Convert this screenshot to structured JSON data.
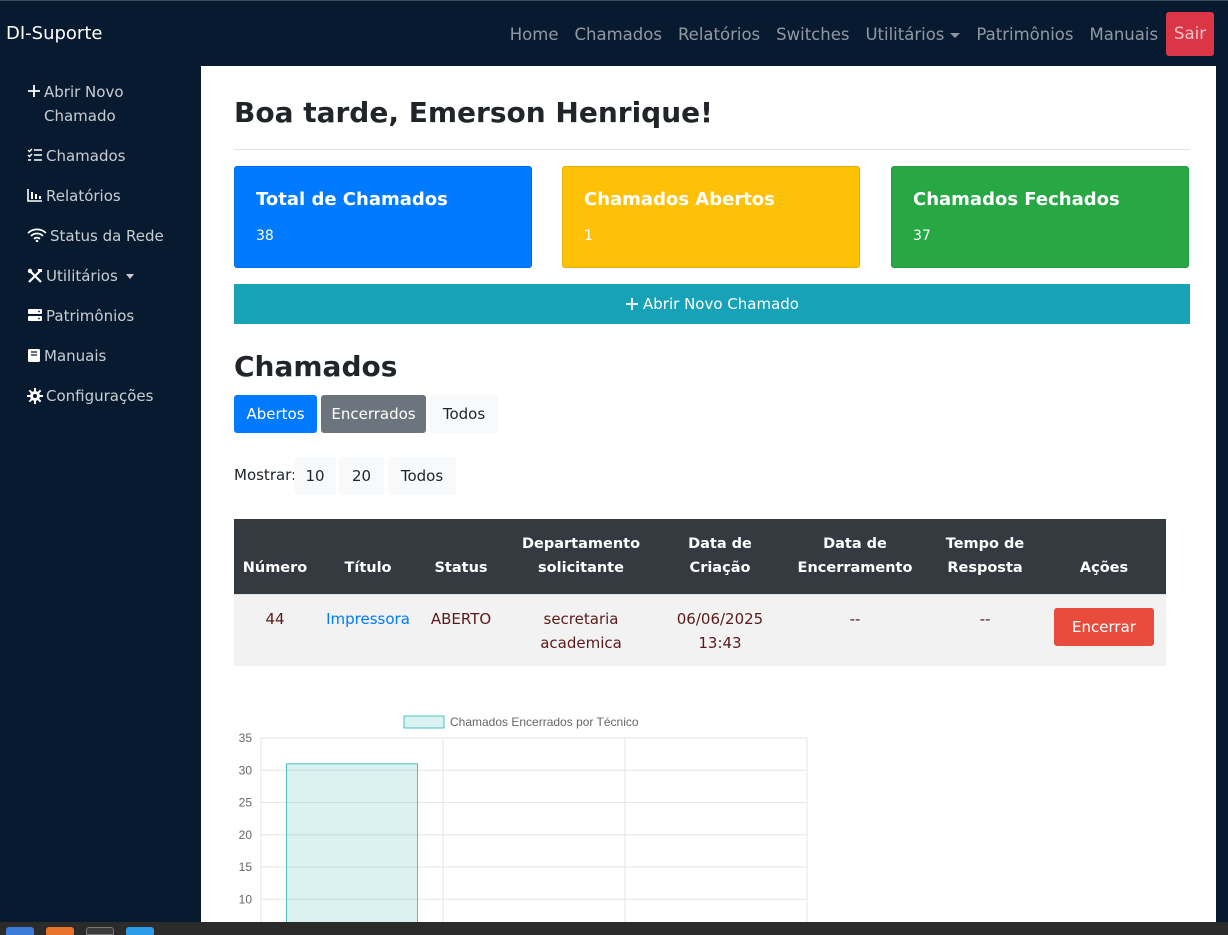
{
  "brand": "DI-Suporte",
  "nav": {
    "home": "Home",
    "chamados": "Chamados",
    "relatorios": "Relatórios",
    "switches": "Switches",
    "utilitarios": "Utilitários",
    "patrimonios": "Patrimônios",
    "manuais": "Manuais",
    "sair": "Sair"
  },
  "sidebar": {
    "items": [
      {
        "label": "Abrir Novo Chamado",
        "icon": "plus-icon"
      },
      {
        "label": "Chamados",
        "icon": "list-check-icon"
      },
      {
        "label": "Relatórios",
        "icon": "bar-chart-icon"
      },
      {
        "label": "Status da Rede",
        "icon": "wifi-icon"
      },
      {
        "label": "Utilitários",
        "icon": "tools-icon"
      },
      {
        "label": "Patrimônios",
        "icon": "server-icon"
      },
      {
        "label": "Manuais",
        "icon": "book-icon"
      },
      {
        "label": "Configurações",
        "icon": "gear-icon"
      }
    ]
  },
  "greeting": "Boa tarde, Emerson Henrique!",
  "cards": {
    "total": {
      "title": "Total de Chamados",
      "value": "38"
    },
    "abertos": {
      "title": "Chamados Abertos",
      "value": "1"
    },
    "fechados": {
      "title": "Chamados Fechados",
      "value": "37"
    }
  },
  "new_ticket_button": "Abrir Novo Chamado",
  "section_title": "Chamados",
  "tabs": {
    "abertos": "Abertos",
    "encerrados": "Encerrados",
    "todos": "Todos"
  },
  "mostrar": {
    "label": "Mostrar:",
    "options": [
      "10",
      "20",
      "Todos"
    ]
  },
  "table": {
    "headers": {
      "numero": "Número",
      "titulo": "Título",
      "status": "Status",
      "departamento_1": "Departamento",
      "departamento_2": "solicitante",
      "criacao_1": "Data de",
      "criacao_2": "Criação",
      "encerramento_1": "Data de",
      "encerramento_2": "Encerramento",
      "tempo_1": "Tempo de",
      "tempo_2": "Resposta",
      "acoes": "Ações"
    },
    "rows": [
      {
        "numero": "44",
        "titulo": "Impressora",
        "status": "ABERTO",
        "departamento_1": "secretaria",
        "departamento_2": "academica",
        "criacao_1": "06/06/2025",
        "criacao_2": "13:43",
        "encerramento": "--",
        "tempo": "--",
        "acao": "Encerrar"
      }
    ]
  },
  "colors": {
    "navbar": "#071a2f",
    "primary": "#007bff",
    "warning": "#ffc107",
    "success": "#28a745",
    "info": "#17a2b8",
    "danger": "#dc3545",
    "encerrar": "#e74c3c"
  },
  "chart_data": {
    "type": "bar",
    "title": "",
    "legend": [
      "Chamados Encerrados por Técnico"
    ],
    "legend_position": "top",
    "categories": [
      "",
      "",
      ""
    ],
    "series": [
      {
        "name": "Chamados Encerrados por Técnico",
        "values": [
          31,
          null,
          null
        ]
      }
    ],
    "y_ticks": [
      "35",
      "30",
      "25",
      "20",
      "15",
      "10"
    ],
    "ylim": [
      0,
      35
    ],
    "grid": true,
    "bar_color": "rgba(75,192,192,0.2)",
    "bar_border": "#4bc0c0"
  }
}
